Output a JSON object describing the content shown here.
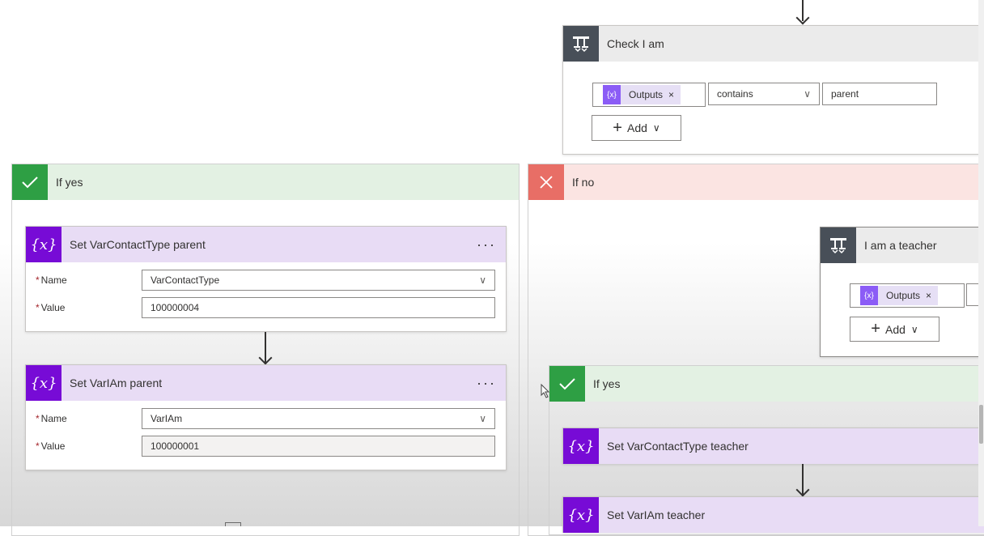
{
  "check": {
    "title": "Check I am",
    "token": "Outputs",
    "operator": "contains",
    "value": "parent",
    "add": "Add"
  },
  "yes_branch": {
    "label": "If yes",
    "set_contact": {
      "title": "Set VarContactType parent",
      "name_label": "Name",
      "name_value": "VarContactType",
      "value_label": "Value",
      "value_value": "100000004"
    },
    "set_iam": {
      "title": "Set VarIAm parent",
      "name_label": "Name",
      "name_value": "VarIAm",
      "value_label": "Value",
      "value_value": "100000001"
    }
  },
  "no_branch": {
    "label": "If no",
    "teacher_check": {
      "title": "I am a teacher",
      "token": "Outputs",
      "add": "Add"
    },
    "nested_yes": {
      "label": "If yes",
      "set_contact_teacher": "Set VarContactType teacher",
      "set_iam_teacher": "Set VarIAm teacher"
    }
  },
  "colors": {
    "yes_green": "#2e9f44",
    "yes_bg": "#e3f1e3",
    "no_red": "#e86e66",
    "no_bg": "#fbe4e2",
    "variable_purple": "#770bd6",
    "variable_header": "#e8dcf5",
    "condition_icon": "#484f58"
  },
  "icons": [
    "condition-icon",
    "variable-icon",
    "check-icon",
    "close-icon",
    "chevron-down-icon",
    "plus-icon",
    "more-icon",
    "arrow-down-icon",
    "cursor-icon"
  ]
}
